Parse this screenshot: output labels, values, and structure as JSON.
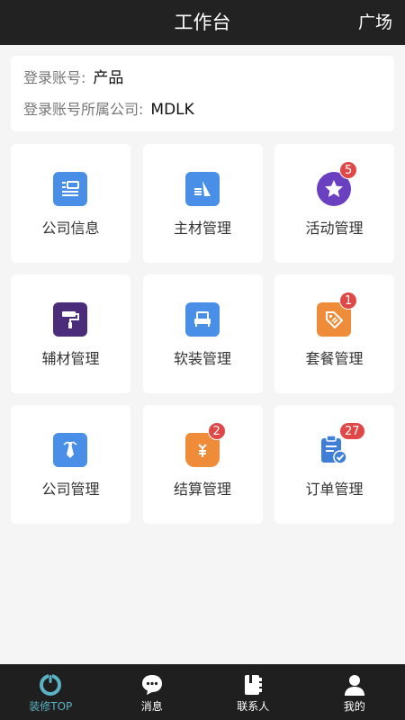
{
  "header": {
    "title": "工作台",
    "right_link": "广场"
  },
  "info": {
    "account_label": "登录账号:",
    "account_value": "产品",
    "company_label": "登录账号所属公司:",
    "company_value": "MDLK"
  },
  "tiles": [
    {
      "label": "公司信息",
      "icon": "company-info-icon",
      "color": "#4a8fe7",
      "badge": ""
    },
    {
      "label": "主材管理",
      "icon": "main-material-icon",
      "color": "#4a8fe7",
      "badge": ""
    },
    {
      "label": "活动管理",
      "icon": "star-icon",
      "color": "#6a3fc0",
      "badge": "5"
    },
    {
      "label": "辅材管理",
      "icon": "paint-roller-icon",
      "color": "#4b2c7a",
      "badge": ""
    },
    {
      "label": "软装管理",
      "icon": "sofa-icon",
      "color": "#4a8fe7",
      "badge": ""
    },
    {
      "label": "套餐管理",
      "icon": "tag-icon",
      "color": "#ef8c3a",
      "badge": "1"
    },
    {
      "label": "公司管理",
      "icon": "tie-icon",
      "color": "#4a8fe7",
      "badge": ""
    },
    {
      "label": "结算管理",
      "icon": "money-bag-icon",
      "color": "#ef8c3a",
      "badge": "2"
    },
    {
      "label": "订单管理",
      "icon": "clipboard-check-icon",
      "color": "#3f7fd8",
      "badge": "27"
    }
  ],
  "tabbar": [
    {
      "label": "装修TOP",
      "icon": "home-ring-icon",
      "active": true
    },
    {
      "label": "消息",
      "icon": "chat-bubble-icon",
      "active": false
    },
    {
      "label": "联系人",
      "icon": "contacts-book-icon",
      "active": false
    },
    {
      "label": "我的",
      "icon": "person-icon",
      "active": false
    }
  ],
  "colors": {
    "header_bg": "#222222",
    "tabbar_bg": "#1f1f1f",
    "accent": "#5ab2c4",
    "badge": "#e04848"
  }
}
